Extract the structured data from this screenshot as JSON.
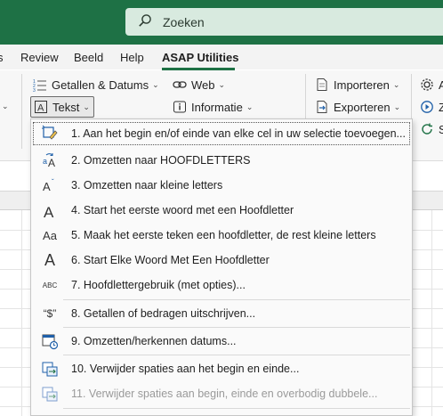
{
  "search": {
    "placeholder": "Zoeken"
  },
  "menu": {
    "items": [
      {
        "label": "s"
      },
      {
        "label": "Review"
      },
      {
        "label": "Beeld"
      },
      {
        "label": "Help"
      },
      {
        "label": "ASAP Utilities"
      }
    ]
  },
  "ribbon": {
    "getallen_datums": "Getallen & Datums",
    "web": "Web",
    "importeren": "Importeren",
    "a_partial": "A",
    "tekst": "Tekst",
    "informatie": "Informatie",
    "exporteren": "Exporteren",
    "z_partial": "Z",
    "s_partial": "S"
  },
  "dropdown": {
    "items": [
      {
        "label": "1. Aan het begin en/of einde van elke cel in uw selectie toevoegen...",
        "icon": "add-text-icon"
      },
      {
        "label": "2. Omzetten naar HOOFDLETTERS",
        "icon": "uppercase-icon"
      },
      {
        "label": "3. Omzetten naar kleine letters",
        "icon": "lowercase-icon"
      },
      {
        "label": "4. Start het eerste woord met een Hoofdletter",
        "icon": "sentence-case-icon"
      },
      {
        "label": "5. Maak het eerste teken een hoofdletter, de rest kleine letters",
        "icon": "capitalize-first-icon"
      },
      {
        "label": "6. Start Elke Woord Met Een Hoofdletter",
        "icon": "title-case-icon"
      },
      {
        "label": "7. Hoofdlettergebruik (met opties)...",
        "icon": "case-options-icon"
      },
      {
        "label": "8. Getallen of bedragen uitschrijven...",
        "icon": "spell-number-icon"
      },
      {
        "label": "9. Omzetten/herkennen datums...",
        "icon": "calendar-icon"
      },
      {
        "label": "10. Verwijder spaties aan het begin en einde...",
        "icon": "trim-spaces-icon"
      },
      {
        "label": "11. Verwijder spaties aan begin, einde en overbodig dubbele...",
        "icon": "trim-double-spaces-icon"
      }
    ],
    "icon_texts": {
      "aa": "Aa",
      "a": "A",
      "abc": "ABC",
      "dollar": "“$”"
    }
  },
  "colors": {
    "title_bar": "#1e7145",
    "search_bg": "#d8eadf",
    "accent": "#1e7145"
  }
}
